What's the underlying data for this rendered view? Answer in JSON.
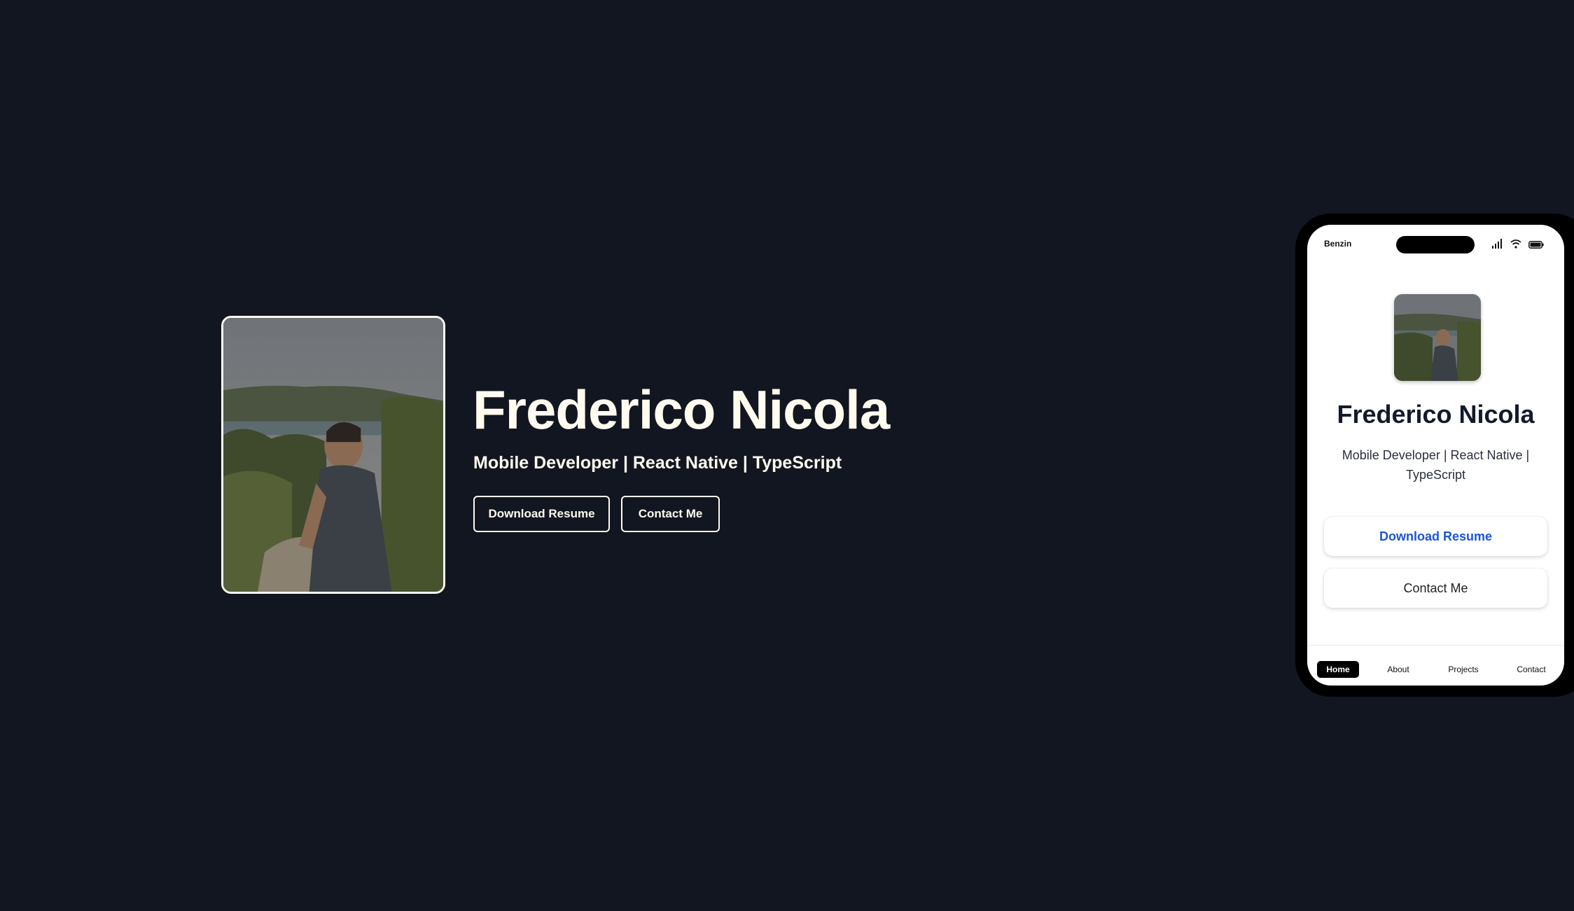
{
  "hero": {
    "name": "Frederico Nicola",
    "subtitle": "Mobile Developer | React Native | TypeScript",
    "download_resume_label": "Download Resume",
    "contact_label": "Contact Me",
    "photo_icon": "portrait-photo"
  },
  "phone": {
    "status": {
      "carrier": "Benzin",
      "signal_icon": "cellular-signal-icon",
      "wifi_icon": "wifi-icon",
      "battery_icon": "battery-icon"
    },
    "name": "Frederico Nicola",
    "subtitle": "Mobile Developer | React Native | TypeScript",
    "download_resume_label": "Download Resume",
    "contact_label": "Contact Me",
    "tabs": [
      {
        "label": "Home",
        "active": true
      },
      {
        "label": "About",
        "active": false
      },
      {
        "label": "Projects",
        "active": false
      },
      {
        "label": "Contact",
        "active": false
      }
    ]
  },
  "colors": {
    "background": "#121621",
    "hero_text": "#fffbef",
    "mobile_accent": "#1a56db"
  }
}
